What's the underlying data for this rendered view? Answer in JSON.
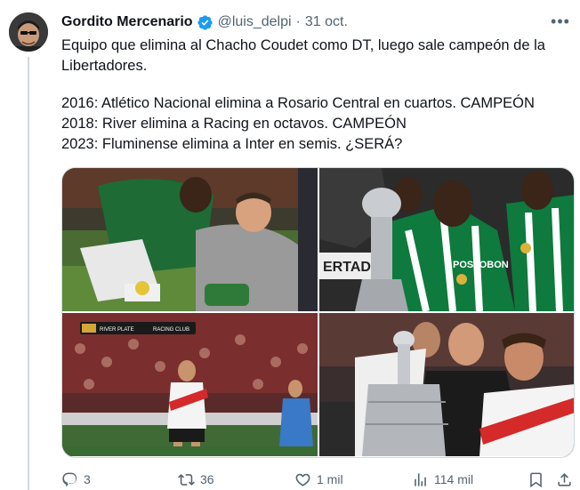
{
  "tweet": {
    "author_name": "Gordito Mercenario",
    "handle": "@luis_delpi",
    "separator": "·",
    "date": "31 oct.",
    "more_label": "•••",
    "text_lines": [
      "Equipo que elimina al Chacho Coudet como DT, luego sale campeón de la",
      "Libertadores."
    ],
    "list_lines": [
      "2016: Atlético Nacional elimina a Rosario Central en cuartos. CAMPEÓN",
      "2018: River elimina a Racing en octavos. CAMPEÓN",
      "2023: Fluminense elimina a Inter en semis. ¿SERÁ?"
    ]
  },
  "media": {
    "images": [
      {
        "name": "photo-nacional-rosario"
      },
      {
        "name": "photo-nacional-trophy"
      },
      {
        "name": "photo-river-racing"
      },
      {
        "name": "photo-river-trophy"
      }
    ],
    "scoreboard_left": "RIVER PLATE",
    "scoreboard_right": "RACING CLUB",
    "banner_text": "ERTAD",
    "sponsor_text": "POSTOBON"
  },
  "actions": {
    "replies": "3",
    "retweets": "36",
    "likes": "1 mil",
    "views": "114 mil"
  },
  "colors": {
    "accent": "#1d9bf0",
    "muted": "#536471",
    "border": "#cfd9de"
  }
}
